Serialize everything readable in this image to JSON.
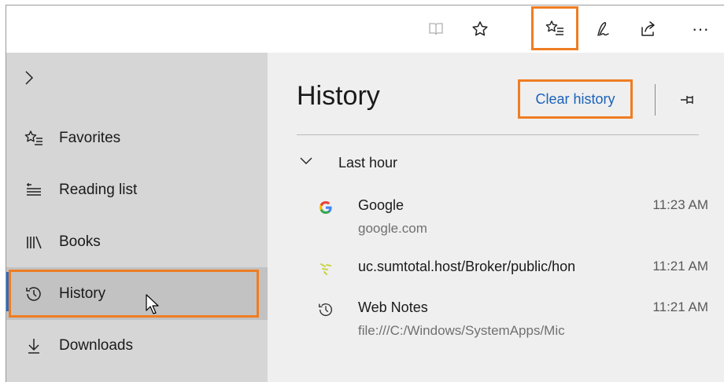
{
  "toolbar": {
    "buttons": [
      {
        "name": "reading-view",
        "icon": "book-icon"
      },
      {
        "name": "add-favorite",
        "icon": "star-icon"
      },
      {
        "name": "hub",
        "icon": "star-list-icon",
        "highlighted": true
      },
      {
        "name": "web-note",
        "icon": "pen-icon"
      },
      {
        "name": "share",
        "icon": "share-icon"
      },
      {
        "name": "more",
        "icon": "more-icon",
        "label": "···"
      }
    ]
  },
  "sidebar": {
    "expand_icon": "chevron-right-icon",
    "items": [
      {
        "label": "Favorites",
        "icon": "star-list-icon"
      },
      {
        "label": "Reading list",
        "icon": "reading-list-icon"
      },
      {
        "label": "Books",
        "icon": "books-icon"
      },
      {
        "label": "History",
        "icon": "history-icon",
        "active": true
      },
      {
        "label": "Downloads",
        "icon": "download-icon"
      }
    ]
  },
  "history": {
    "title": "History",
    "clear_label": "Clear history",
    "pin_icon": "pin-icon",
    "group": {
      "label": "Last hour",
      "icon": "chevron-down-icon"
    },
    "entries": [
      {
        "title": "Google",
        "subtitle": "google.com",
        "time": "11:23 AM",
        "icon": "google-icon"
      },
      {
        "title": "uc.sumtotal.host/Broker/public/hon",
        "subtitle": "",
        "time": "11:21 AM",
        "icon": "sumtotal-icon"
      },
      {
        "title": "Web Notes",
        "subtitle": "file:///C:/Windows/SystemApps/Mic",
        "time": "11:21 AM",
        "icon": "history-icon"
      }
    ]
  },
  "colors": {
    "highlight": "#ef7d22",
    "link": "#1b62b9",
    "active_bar": "#2b6cc4",
    "sidebar_bg": "#d6d6d6",
    "pane_bg": "#efefef"
  }
}
